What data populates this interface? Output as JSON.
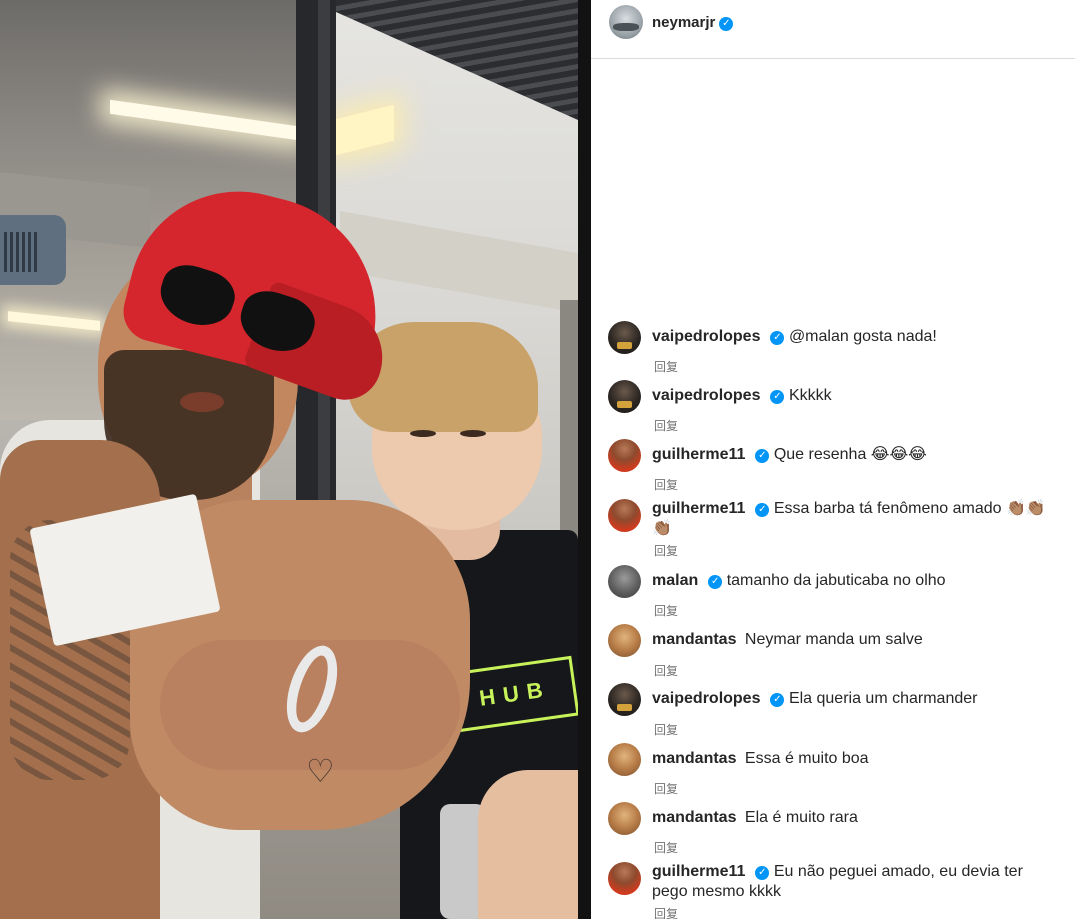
{
  "header": {
    "username": "neymarjr",
    "verified": true
  },
  "comments": [
    {
      "username": "vaipedrolopes",
      "verified": true,
      "text": "@malan gosta nada!",
      "reply_label": "回复",
      "avatar": "dark"
    },
    {
      "username": "vaipedrolopes",
      "verified": true,
      "text": "Kkkkk",
      "reply_label": "回复",
      "avatar": "dark"
    },
    {
      "username": "guilherme11",
      "verified": true,
      "text": "Que resenha 😂😂😂",
      "reply_label": "回复",
      "avatar": "red"
    },
    {
      "username": "guilherme11",
      "verified": true,
      "text": "Essa barba tá fenômeno amado 👏🏽👏🏽👏🏽",
      "reply_label": "回复",
      "avatar": "red"
    },
    {
      "username": "malan",
      "verified": true,
      "text": "tamanho da jabuticaba no olho",
      "reply_label": "回复",
      "avatar": "gray"
    },
    {
      "username": "mandantas",
      "verified": false,
      "text": "Neymar manda um salve",
      "reply_label": "回复",
      "avatar": "gold"
    },
    {
      "username": "vaipedrolopes",
      "verified": true,
      "text": "Ela queria um charmander",
      "reply_label": "回复",
      "avatar": "dark"
    },
    {
      "username": "mandantas",
      "verified": false,
      "text": "Essa é muito boa",
      "reply_label": "回复",
      "avatar": "gold"
    },
    {
      "username": "mandantas",
      "verified": false,
      "text": "Ela é muito rara",
      "reply_label": "回复",
      "avatar": "gold"
    },
    {
      "username": "guilherme11",
      "verified": true,
      "text": "Eu não peguei amado, eu devia ter pego mesmo kkkk",
      "reply_label": "回复",
      "avatar": "red"
    }
  ],
  "video": {
    "shirt_logo": "HUB"
  },
  "colors": {
    "verified_badge": "#0095f6",
    "text_primary": "#262626",
    "text_secondary": "#737373",
    "divider": "#121212"
  }
}
